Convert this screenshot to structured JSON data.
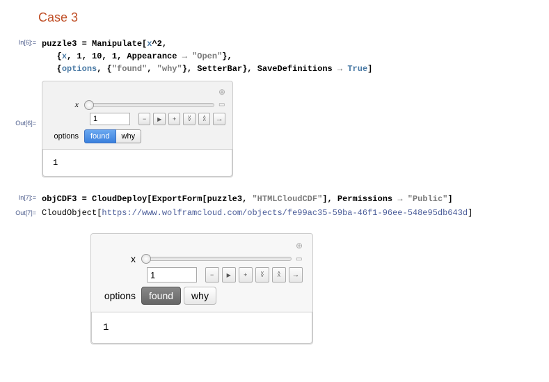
{
  "heading": "Case 3",
  "in6_label": "In[6]:=",
  "out6_label": "Out[6]=",
  "in7_label": "In[7]:=",
  "out7_label": "Out[7]=",
  "code_in6": {
    "line1_a": "puzzle3 = Manipulate",
    "line1_b": "x",
    "line1_c": "^2,",
    "line2_a": "   {",
    "line2_b": "x",
    "line2_c": ", 1, 10, 1, Appearance",
    "line2_arrow": " → ",
    "line2_d": "\"Open\"",
    "line2_e": "},",
    "line3_a": "   {",
    "line3_b": "options",
    "line3_c": ", {",
    "line3_d": "\"found\"",
    "line3_e": ", ",
    "line3_f": "\"why\"",
    "line3_g": "}, SetterBar}, SaveDefinitions",
    "line3_arrow": " → ",
    "line3_h": "True",
    "line3_i": "]"
  },
  "panel1": {
    "var_label": "x",
    "input_value": "1",
    "options_label": "options",
    "opt1": "found",
    "opt2": "why",
    "output": "1"
  },
  "code_in7": {
    "a": "objCDF3 = CloudDeploy",
    "b": "ExportForm",
    "c": "puzzle3, ",
    "d": "\"HTMLCloudCDF\"",
    "e": ", Permissions",
    "arrow": " → ",
    "f": "\"Public\""
  },
  "out7": {
    "obj": "CloudObject",
    "open": "[",
    "url": "https://www.wolframcloud.com/objects/fe99ac35-59ba-46f1-96ee-548e95db643d",
    "close": "]"
  },
  "panel2": {
    "var_label": "x",
    "input_value": "1",
    "options_label": "options",
    "opt1": "found",
    "opt2": "why",
    "output": "1"
  }
}
